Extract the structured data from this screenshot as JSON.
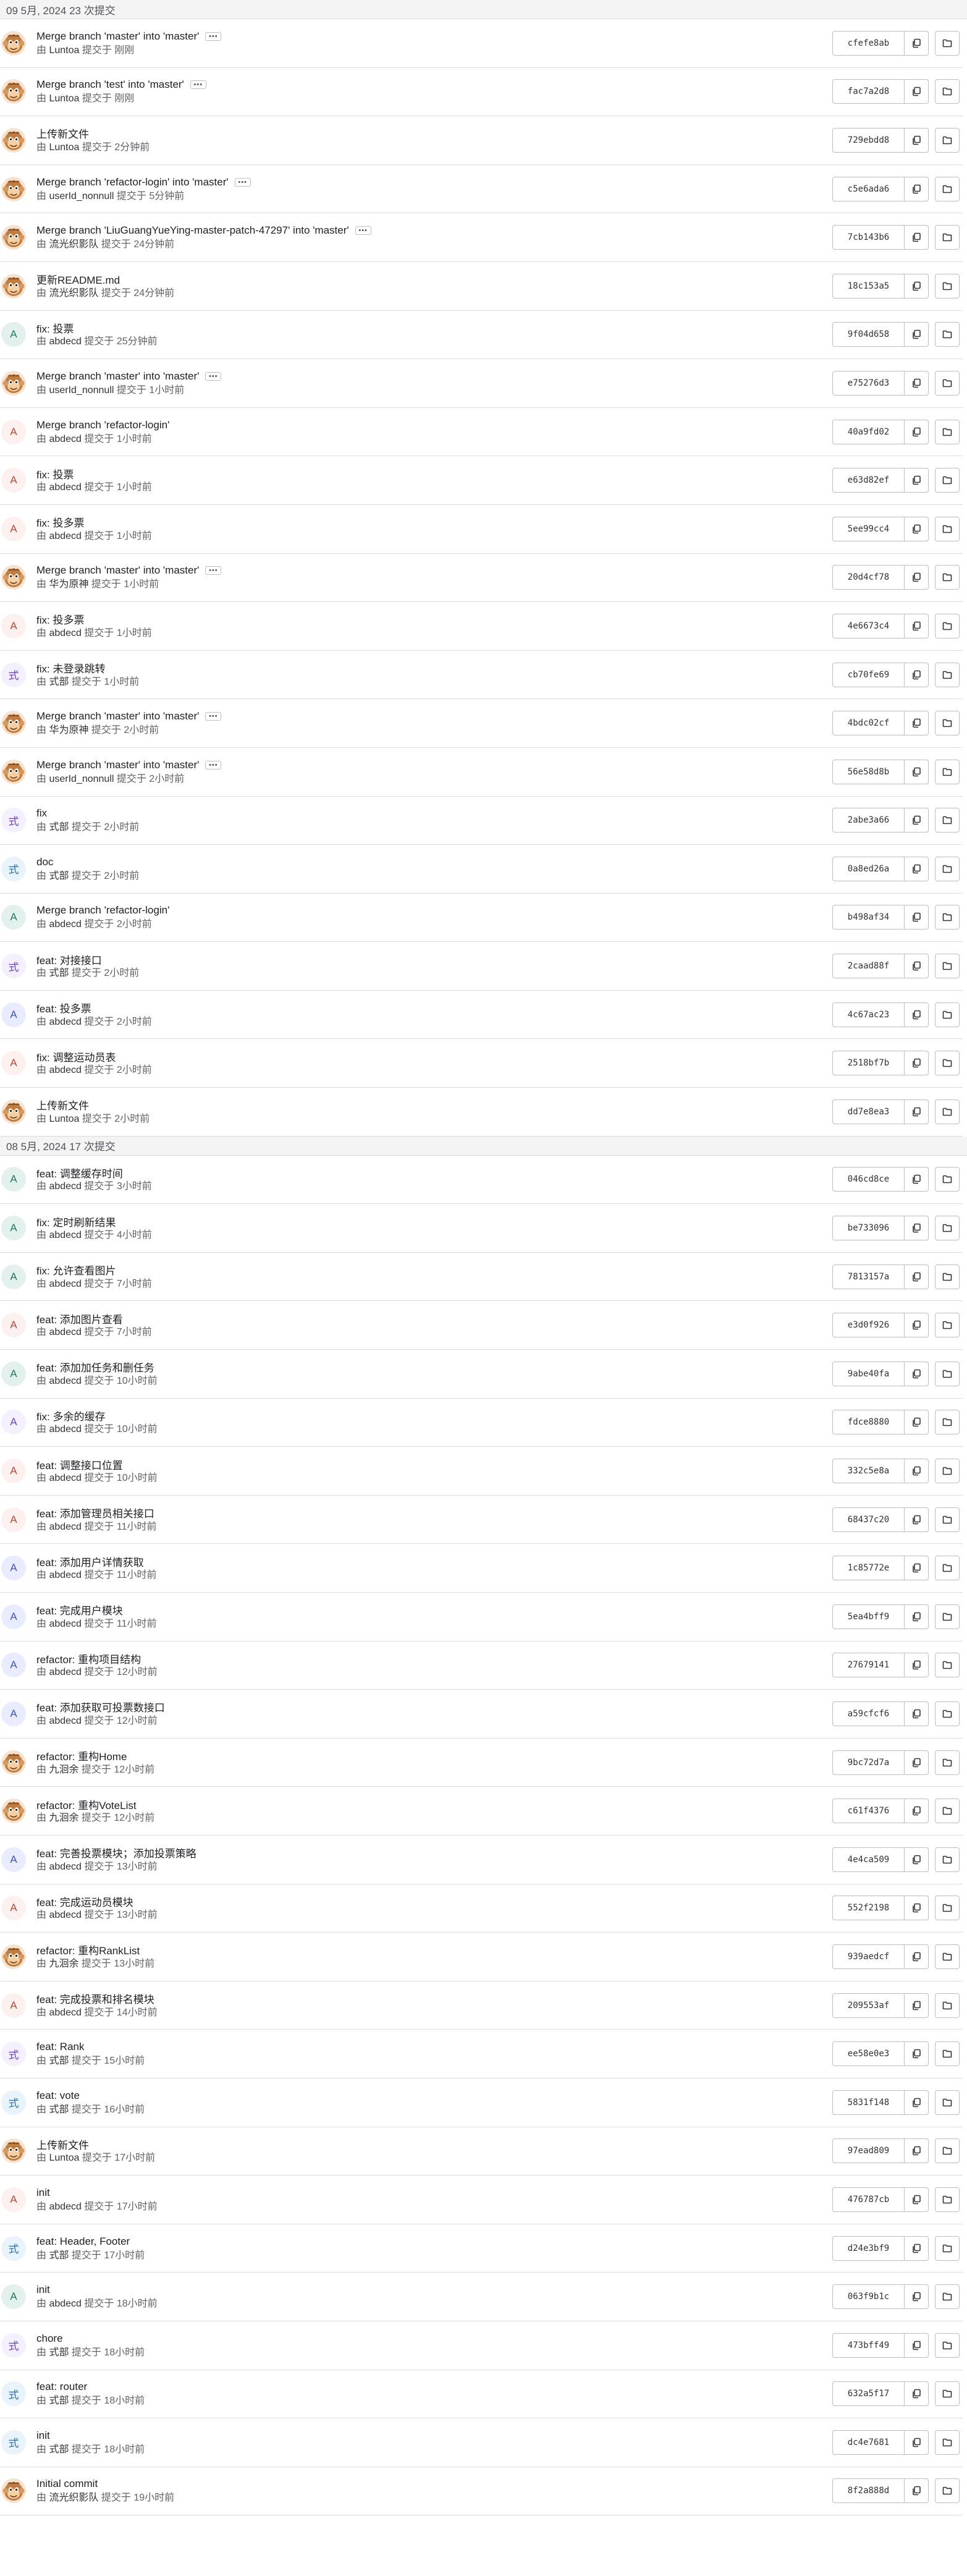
{
  "colors": {
    "avatar_a_blue": "#e9ebff",
    "avatar_a_pink": "#fcf1ef",
    "avatar_a_green": "#e3f1ee",
    "avatar_shi_purple": "#f4f0ff",
    "avatar_shi_blue": "#e9f3fc",
    "monkey": "#c17d3f"
  },
  "icons": {
    "copy": "copy-icon",
    "browse": "folder-icon",
    "more": "ellipsis-icon"
  },
  "meta_by": "由",
  "meta_committed": "提交于",
  "groups": [
    {
      "header": "09 5月, 2024 23 次提交",
      "commits": [
        {
          "title": "Merge branch 'master' into 'master'",
          "author": "Luntoa",
          "time": "刚刚",
          "sha": "cfefe8ab",
          "avatar": "monkey",
          "more": true
        },
        {
          "title": "Merge branch 'test' into 'master'",
          "author": "Luntoa",
          "time": "刚刚",
          "sha": "fac7a2d8",
          "avatar": "monkey",
          "more": true
        },
        {
          "title": "上传新文件",
          "author": "Luntoa",
          "time": "2分钟前",
          "sha": "729ebdd8",
          "avatar": "monkey",
          "more": false
        },
        {
          "title": "Merge branch 'refactor-login' into 'master'",
          "author": "userId_nonnull",
          "time": "5分钟前",
          "sha": "c5e6ada6",
          "avatar": "monkey",
          "more": true
        },
        {
          "title": "Merge branch 'LiuGuangYueYing-master-patch-47297' into 'master'",
          "author": "流光织影队",
          "time": "24分钟前",
          "sha": "7cb143b6",
          "avatar": "monkey",
          "more": true
        },
        {
          "title": "更新README.md",
          "author": "流光织影队",
          "time": "24分钟前",
          "sha": "18c153a5",
          "avatar": "monkey",
          "more": false
        },
        {
          "title": "fix: 投票",
          "author": "abdecd",
          "time": "25分钟前",
          "sha": "9f04d658",
          "avatar": "A-green",
          "more": false
        },
        {
          "title": "Merge branch 'master' into 'master'",
          "author": "userId_nonnull",
          "time": "1小时前",
          "sha": "e75276d3",
          "avatar": "monkey",
          "more": true
        },
        {
          "title": "Merge branch 'refactor-login'",
          "author": "abdecd",
          "time": "1小时前",
          "sha": "40a9fd02",
          "avatar": "A-pink",
          "more": false
        },
        {
          "title": "fix: 投票",
          "author": "abdecd",
          "time": "1小时前",
          "sha": "e63d82ef",
          "avatar": "A-pink",
          "more": false
        },
        {
          "title": "fix: 投多票",
          "author": "abdecd",
          "time": "1小时前",
          "sha": "5ee99cc4",
          "avatar": "A-pink",
          "more": false
        },
        {
          "title": "Merge branch 'master' into 'master'",
          "author": "华为原神",
          "time": "1小时前",
          "sha": "20d4cf78",
          "avatar": "monkey",
          "more": true
        },
        {
          "title": "fix: 投多票",
          "author": "abdecd",
          "time": "1小时前",
          "sha": "4e6673c4",
          "avatar": "A-pink",
          "more": false
        },
        {
          "title": "fix: 未登录跳转",
          "author": "式部",
          "time": "1小时前",
          "sha": "cb70fe69",
          "avatar": "shi-purple",
          "more": false
        },
        {
          "title": "Merge branch 'master' into 'master'",
          "author": "华为原神",
          "time": "2小时前",
          "sha": "4bdc02cf",
          "avatar": "monkey",
          "more": true
        },
        {
          "title": "Merge branch 'master' into 'master'",
          "author": "userId_nonnull",
          "time": "2小时前",
          "sha": "56e58d8b",
          "avatar": "monkey",
          "more": true
        },
        {
          "title": "fix",
          "author": "式部",
          "time": "2小时前",
          "sha": "2abe3a66",
          "avatar": "shi-purple",
          "more": false
        },
        {
          "title": "doc",
          "author": "式部",
          "time": "2小时前",
          "sha": "0a8ed26a",
          "avatar": "shi-blue",
          "more": false
        },
        {
          "title": "Merge branch 'refactor-login'",
          "author": "abdecd",
          "time": "2小时前",
          "sha": "b498af34",
          "avatar": "A-green",
          "more": false
        },
        {
          "title": "feat: 对接接口",
          "author": "式部",
          "time": "2小时前",
          "sha": "2caad88f",
          "avatar": "shi-purple",
          "more": false
        },
        {
          "title": "feat: 投多票",
          "author": "abdecd",
          "time": "2小时前",
          "sha": "4c67ac23",
          "avatar": "A-blue",
          "more": false
        },
        {
          "title": "fix: 调整运动员表",
          "author": "abdecd",
          "time": "2小时前",
          "sha": "2518bf7b",
          "avatar": "A-pink",
          "more": false
        },
        {
          "title": "上传新文件",
          "author": "Luntoa",
          "time": "2小时前",
          "sha": "dd7e8ea3",
          "avatar": "monkey",
          "more": false
        }
      ]
    },
    {
      "header": "08 5月, 2024 17 次提交",
      "commits": [
        {
          "title": "feat: 调整缓存时间",
          "author": "abdecd",
          "time": "3小时前",
          "sha": "046cd8ce",
          "avatar": "A-green",
          "more": false
        },
        {
          "title": "fix: 定时刷新结果",
          "author": "abdecd",
          "time": "4小时前",
          "sha": "be733096",
          "avatar": "A-green",
          "more": false
        },
        {
          "title": "fix: 允许查看图片",
          "author": "abdecd",
          "time": "7小时前",
          "sha": "7813157a",
          "avatar": "A-green",
          "more": false
        },
        {
          "title": "feat: 添加图片查看",
          "author": "abdecd",
          "time": "7小时前",
          "sha": "e3d0f926",
          "avatar": "A-pink",
          "more": false
        },
        {
          "title": "feat: 添加加任务和删任务",
          "author": "abdecd",
          "time": "10小时前",
          "sha": "9abe40fa",
          "avatar": "A-green",
          "more": false
        },
        {
          "title": "fix: 多余的缓存",
          "author": "abdecd",
          "time": "10小时前",
          "sha": "fdce8880",
          "avatar": "A-purple",
          "more": false
        },
        {
          "title": "feat: 调整接口位置",
          "author": "abdecd",
          "time": "10小时前",
          "sha": "332c5e8a",
          "avatar": "A-pink",
          "more": false
        },
        {
          "title": "feat: 添加管理员相关接口",
          "author": "abdecd",
          "time": "11小时前",
          "sha": "68437c20",
          "avatar": "A-pink",
          "more": false
        },
        {
          "title": "feat: 添加用户详情获取",
          "author": "abdecd",
          "time": "11小时前",
          "sha": "1c85772e",
          "avatar": "A-blue",
          "more": false
        },
        {
          "title": "feat: 完成用户模块",
          "author": "abdecd",
          "time": "11小时前",
          "sha": "5ea4bff9",
          "avatar": "A-blue",
          "more": false
        },
        {
          "title": "refactor: 重构项目结构",
          "author": "abdecd",
          "time": "12小时前",
          "sha": "27679141",
          "avatar": "A-blue",
          "more": false
        },
        {
          "title": "feat: 添加获取可投票数接口",
          "author": "abdecd",
          "time": "12小时前",
          "sha": "a59cfcf6",
          "avatar": "A-blue",
          "more": false
        },
        {
          "title": "refactor: 重构Home",
          "author": "九洄余",
          "time": "12小时前",
          "sha": "9bc72d7a",
          "avatar": "monkey",
          "more": false
        },
        {
          "title": "refactor: 重构VoteList",
          "author": "九洄余",
          "time": "12小时前",
          "sha": "c61f4376",
          "avatar": "monkey",
          "more": false
        },
        {
          "title": "feat: 完善投票模块；添加投票策略",
          "author": "abdecd",
          "time": "13小时前",
          "sha": "4e4ca509",
          "avatar": "A-blue",
          "more": false
        },
        {
          "title": "feat: 完成运动员模块",
          "author": "abdecd",
          "time": "13小时前",
          "sha": "552f2198",
          "avatar": "A-pink",
          "more": false
        },
        {
          "title": "refactor: 重构RankList",
          "author": "九洄余",
          "time": "13小时前",
          "sha": "939aedcf",
          "avatar": "monkey",
          "more": false
        },
        {
          "title": "feat: 完成投票和排名模块",
          "author": "abdecd",
          "time": "14小时前",
          "sha": "209553af",
          "avatar": "A-pink",
          "more": false
        },
        {
          "title": "feat: Rank",
          "author": "式部",
          "time": "15小时前",
          "sha": "ee58e0e3",
          "avatar": "shi-purple",
          "more": false
        },
        {
          "title": "feat: vote",
          "author": "式部",
          "time": "16小时前",
          "sha": "5831f148",
          "avatar": "shi-blue",
          "more": false
        },
        {
          "title": "上传新文件",
          "author": "Luntoa",
          "time": "17小时前",
          "sha": "97ead809",
          "avatar": "monkey",
          "more": false
        },
        {
          "title": "init",
          "author": "abdecd",
          "time": "17小时前",
          "sha": "476787cb",
          "avatar": "A-pink",
          "more": false
        },
        {
          "title": "feat: Header, Footer",
          "author": "式部",
          "time": "17小时前",
          "sha": "d24e3bf9",
          "avatar": "shi-blue",
          "more": false
        },
        {
          "title": "init",
          "author": "abdecd",
          "time": "18小时前",
          "sha": "063f9b1c",
          "avatar": "A-green",
          "more": false
        },
        {
          "title": "chore",
          "author": "式部",
          "time": "18小时前",
          "sha": "473bff49",
          "avatar": "shi-purple",
          "more": false
        },
        {
          "title": "feat: router",
          "author": "式部",
          "time": "18小时前",
          "sha": "632a5f17",
          "avatar": "shi-blue",
          "more": false
        },
        {
          "title": "init",
          "author": "式部",
          "time": "18小时前",
          "sha": "dc4e7681",
          "avatar": "shi-blue",
          "more": false
        },
        {
          "title": "Initial commit",
          "author": "流光织影队",
          "time": "19小时前",
          "sha": "8f2a888d",
          "avatar": "monkey",
          "more": false
        }
      ]
    }
  ]
}
